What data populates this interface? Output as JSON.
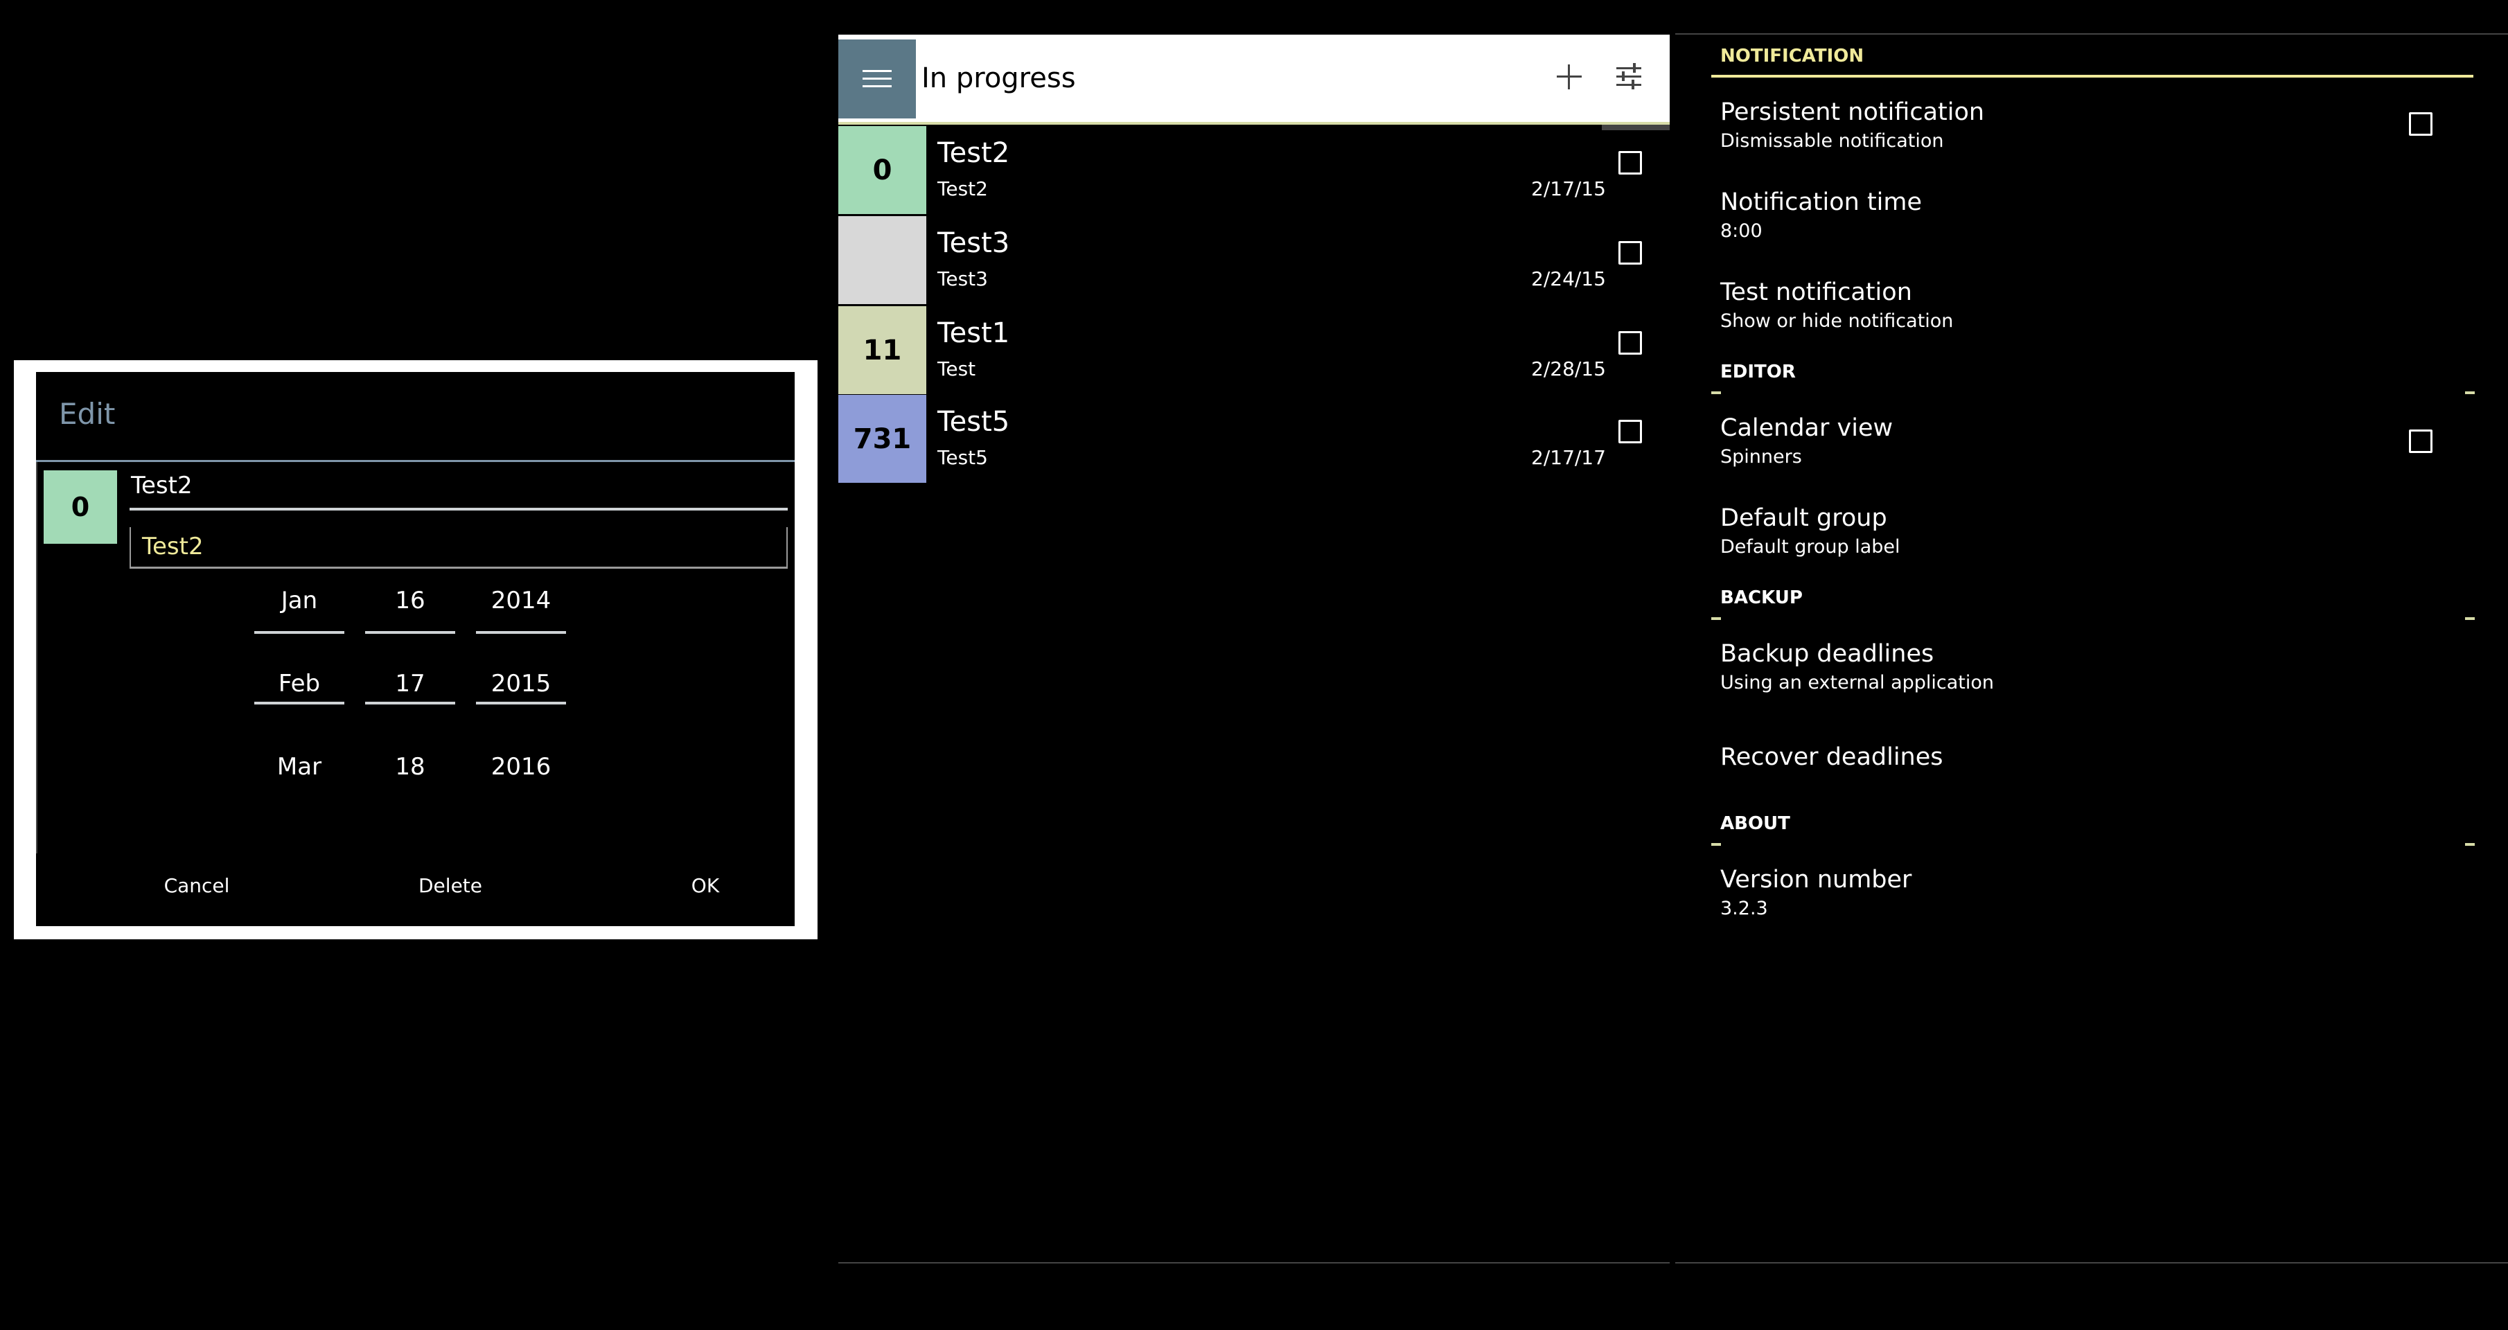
{
  "edit_dialog": {
    "title": "Edit",
    "badge": "0",
    "badge_color": "#a2dab6",
    "name_value": "Test2",
    "description_value": "Test2",
    "date_picker": {
      "months": [
        "Jan",
        "Feb",
        "Mar"
      ],
      "days": [
        "16",
        "17",
        "18"
      ],
      "years": [
        "2014",
        "2015",
        "2016"
      ],
      "selected": {
        "month": "Feb",
        "day": "17",
        "year": "2015"
      }
    },
    "buttons": {
      "cancel": "Cancel",
      "delete": "Delete",
      "ok": "OK"
    }
  },
  "list_screen": {
    "toolbar_title": "In progress",
    "menu_icon": "menu-icon",
    "add_icon": "add-icon",
    "filter_icon": "sliders-icon",
    "items": [
      {
        "badge": "0",
        "badge_color": "#a2dab6",
        "title": "Test2",
        "subtitle": "Test2",
        "date": "2/17/15"
      },
      {
        "badge": "",
        "badge_color": "#d8d8d8",
        "title": "Test3",
        "subtitle": "Test3",
        "date": "2/24/15"
      },
      {
        "badge": "11",
        "badge_color": "#d1d8b3",
        "title": "Test1",
        "subtitle": "Test",
        "date": "2/28/15"
      },
      {
        "badge": "731",
        "badge_color": "#8e9cd8",
        "title": "Test5",
        "subtitle": "Test5",
        "date": "2/17/17"
      }
    ]
  },
  "settings": {
    "accent_color": "#f0ea9a",
    "sections": {
      "notification": "NOTIFICATION",
      "editor": "EDITOR",
      "backup": "BACKUP",
      "about": "ABOUT"
    },
    "prefs": {
      "persistent": {
        "title": "Persistent notification",
        "summary": "Dismissable notification"
      },
      "time": {
        "title": "Notification time",
        "summary": "8:00"
      },
      "test": {
        "title": "Test notification",
        "summary": "Show or hide notification"
      },
      "calendar": {
        "title": "Calendar view",
        "summary": "Spinners"
      },
      "group": {
        "title": "Default group",
        "summary": "Default group label"
      },
      "backup": {
        "title": "Backup deadlines",
        "summary": "Using an external application"
      },
      "recover": {
        "title": "Recover deadlines"
      },
      "version": {
        "title": "Version number",
        "summary": "3.2.3"
      }
    }
  }
}
